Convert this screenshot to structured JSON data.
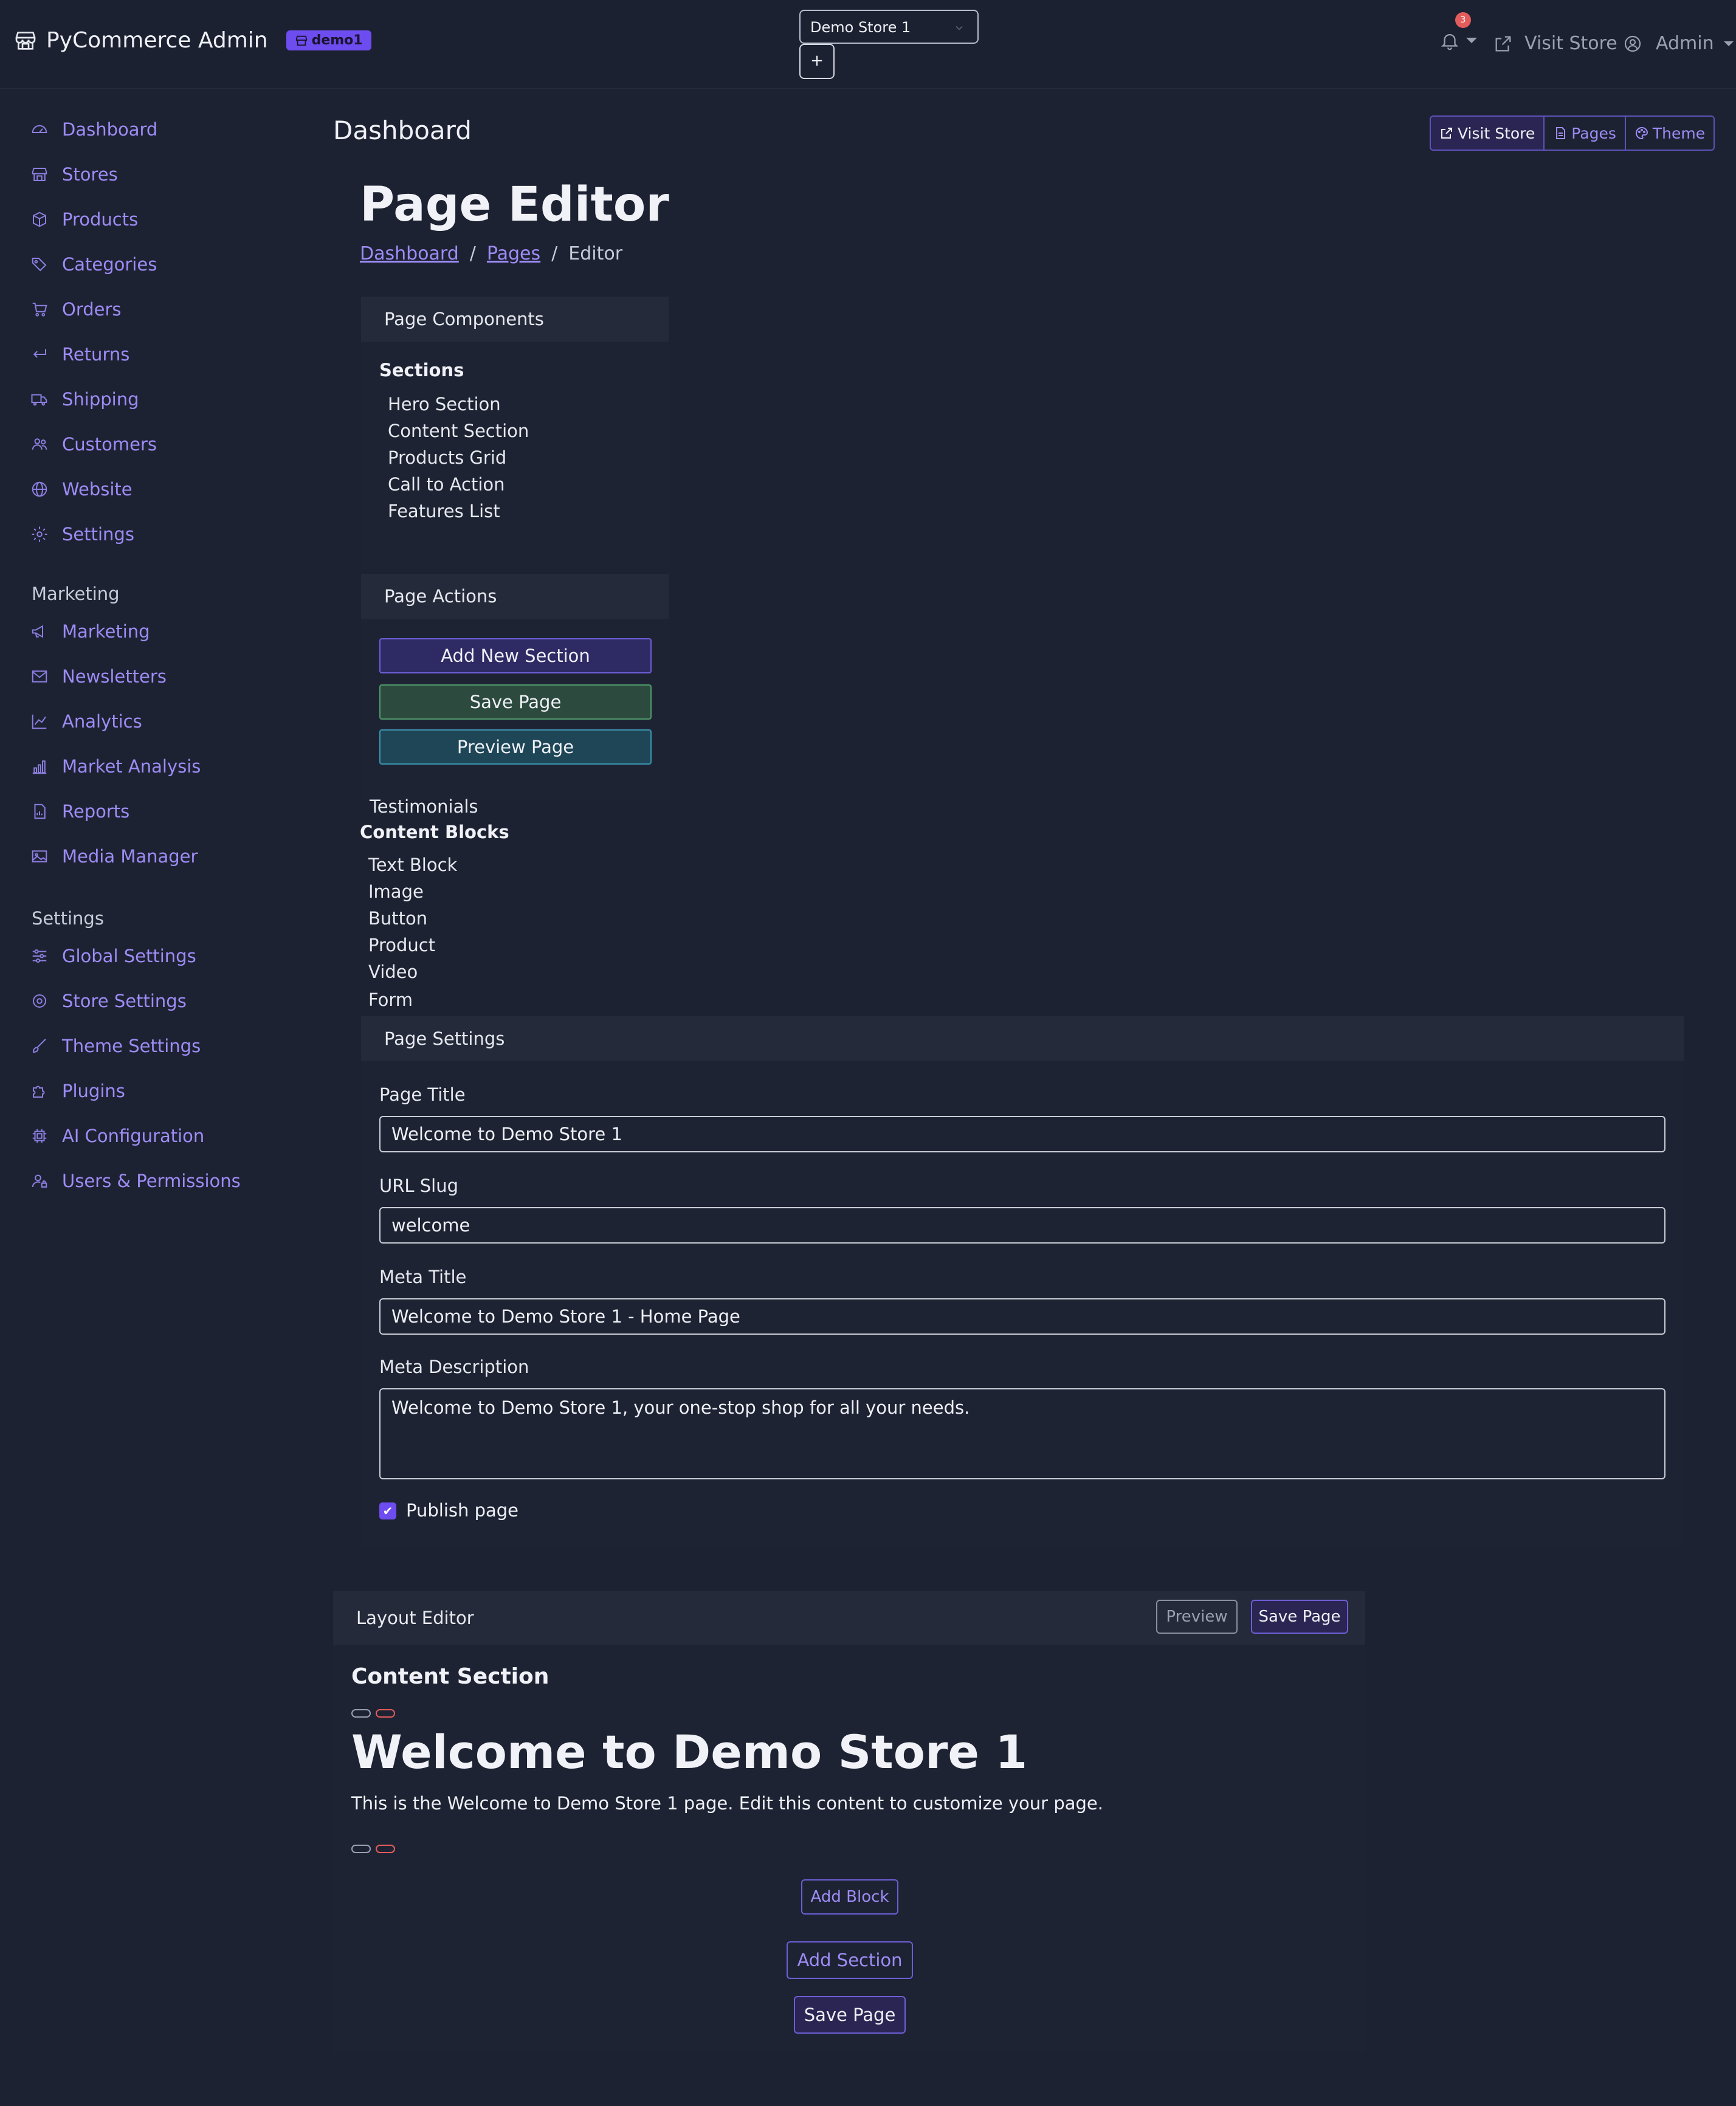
{
  "topbar": {
    "brand_title": "PyCommerce Admin",
    "badge": "demo1",
    "store_select": "Demo Store 1",
    "plus_label": "+",
    "notif_count": "3",
    "visit_store": "Visit Store",
    "admin": "Admin"
  },
  "sidebar": {
    "main_items": [
      "Dashboard",
      "Stores",
      "Products",
      "Categories",
      "Orders",
      "Returns",
      "Shipping",
      "Customers",
      "Website",
      "Settings"
    ],
    "marketing_heading": "Marketing",
    "marketing_items": [
      "Marketing",
      "Newsletters",
      "Analytics",
      "Market Analysis",
      "Reports",
      "Media Manager"
    ],
    "settings_heading": "Settings",
    "settings_items": [
      "Global Settings",
      "Store Settings",
      "Theme Settings",
      "Plugins",
      "AI Configuration",
      "Users & Permissions"
    ]
  },
  "header": {
    "title": "Dashboard",
    "buttons": [
      "Visit Store",
      "Pages",
      "Theme"
    ]
  },
  "page": {
    "h1": "Page Editor",
    "breadcrumb": [
      "Dashboard",
      "Pages",
      "Editor"
    ],
    "breadcrumb_sep": "/"
  },
  "components": {
    "header": "Page Components",
    "sections_heading": "Sections",
    "sections": [
      "Hero Section",
      "Content Section",
      "Products Grid",
      "Call to Action",
      "Features List"
    ],
    "overflow_section": "Testimonials",
    "blocks_heading": "Content Blocks",
    "blocks": [
      "Text Block",
      "Image",
      "Button",
      "Product",
      "Video",
      "Form"
    ]
  },
  "actions": {
    "header": "Page Actions",
    "add_section": "Add New Section",
    "save_page": "Save Page",
    "preview_page": "Preview Page"
  },
  "settings": {
    "header": "Page Settings",
    "page_title_label": "Page Title",
    "page_title_value": "Welcome to Demo Store 1",
    "slug_label": "URL Slug",
    "slug_value": "welcome",
    "meta_title_label": "Meta Title",
    "meta_title_value": "Welcome to Demo Store 1 - Home Page",
    "meta_desc_label": "Meta Description",
    "meta_desc_value": "Welcome to Demo Store 1, your one-stop shop for all your needs.",
    "publish_label": "Publish page",
    "publish_checked": true
  },
  "layout_editor": {
    "header": "Layout Editor",
    "preview_btn": "Preview",
    "save_btn": "Save Page",
    "section_title": "Content Section",
    "heading": "Welcome to Demo Store 1",
    "body": "This is the Welcome to Demo Store 1 page. Edit this content to customize your page.",
    "add_block": "Add Block",
    "add_section": "Add Section",
    "save_page": "Save Page"
  },
  "colors": {
    "background": "#1d2232",
    "accent": "#6d4df0",
    "link": "#9d8cf5",
    "danger": "#e25c5c"
  }
}
